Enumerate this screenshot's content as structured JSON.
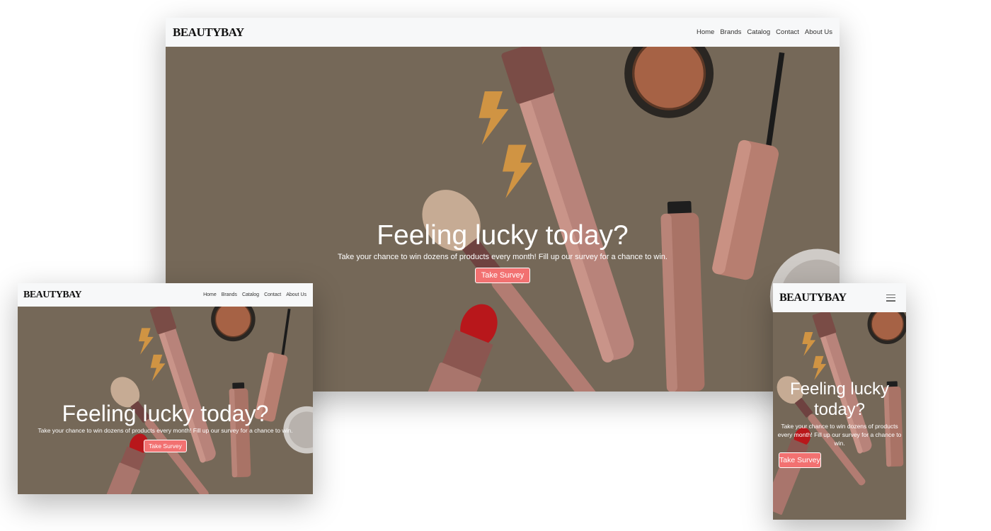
{
  "brand": "BEAUTYBAY",
  "nav": [
    "Home",
    "Brands",
    "Catalog",
    "Contact",
    "About Us"
  ],
  "hero": {
    "title": "Feeling lucky today?",
    "subtitle": "Take your chance to win dozens of products every month! Fill up our survey for a chance to win.",
    "cta": "Take Survey"
  },
  "icons": {
    "menu": "hamburger-menu-icon"
  },
  "colors": {
    "hero_background": "#756858",
    "cta_background": "#f27171",
    "navbar_background": "#f7f8f9"
  }
}
